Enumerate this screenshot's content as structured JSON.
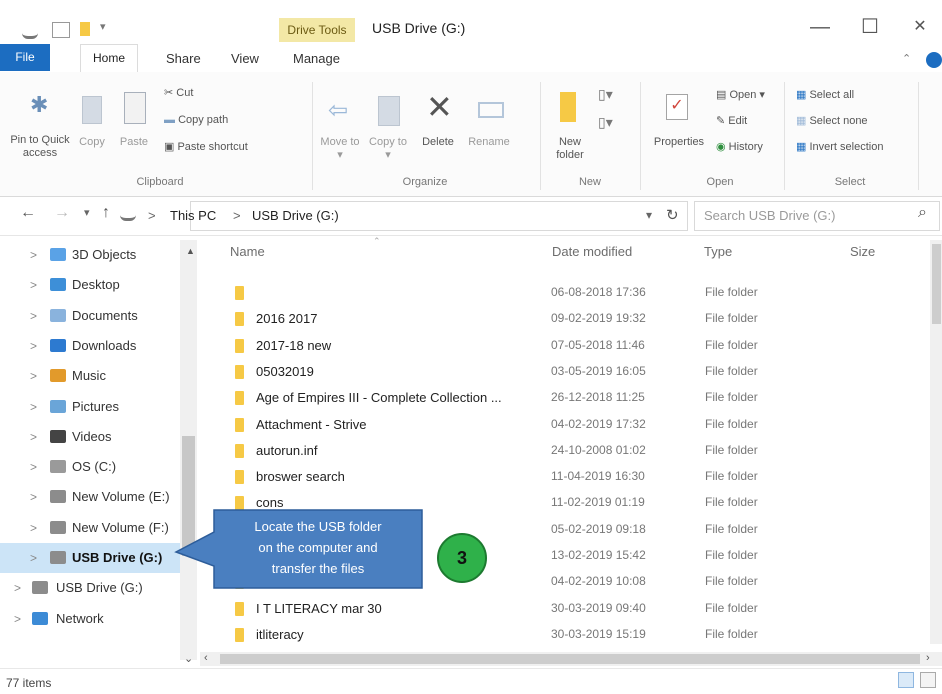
{
  "window": {
    "title": "USB Drive (G:)",
    "contextual_tab": "Drive Tools",
    "minimize": "—",
    "maximize": "☐",
    "close": "✕"
  },
  "ribbon_tabs": [
    "File",
    "Home",
    "Share",
    "View",
    "Manage"
  ],
  "ribbon": {
    "clipboard": {
      "pin_label": "Pin to Quick access",
      "copy_label": "Copy",
      "paste_label": "Paste",
      "cut_label": "Cut",
      "copy_path_label": "Copy path",
      "paste_shortcut_label": "Paste shortcut",
      "group_label": "Clipboard"
    },
    "organize": {
      "move_to_label": "Move to ▾",
      "copy_to_label": "Copy to ▾",
      "delete_label": "Delete",
      "rename_label": "Rename",
      "group_label": "Organize"
    },
    "new": {
      "new_folder_label": "New folder",
      "group_label": "New"
    },
    "open": {
      "properties_label": "Properties",
      "open_label": "Open ▾",
      "edit_label": "Edit",
      "history_label": "History",
      "group_label": "Open"
    },
    "select": {
      "select_all_label": "Select all",
      "select_none_label": "Select none",
      "invert_label": "Invert selection",
      "group_label": "Select"
    }
  },
  "address": {
    "back": "←",
    "forward": "→",
    "recent": "▾",
    "up": "↑",
    "breadcrumb_root": "This PC",
    "breadcrumb_sep": ">",
    "breadcrumb_current": "USB Drive (G:)",
    "dropdown": "▾",
    "refresh": "↻",
    "search_placeholder": "Search USB Drive (G:)",
    "search_icon": "⌕"
  },
  "nav": [
    {
      "label": "3D Objects",
      "icon_color": "#5aa2e6",
      "selected": false
    },
    {
      "label": "Desktop",
      "icon_color": "#3d8fd8",
      "selected": false
    },
    {
      "label": "Documents",
      "icon_color": "#8ab3dd",
      "selected": false
    },
    {
      "label": "Downloads",
      "icon_color": "#2d7ad0",
      "selected": false
    },
    {
      "label": "Music",
      "icon_color": "#e29a2b",
      "selected": false
    },
    {
      "label": "Pictures",
      "icon_color": "#6aa5d8",
      "selected": false
    },
    {
      "label": "Videos",
      "icon_color": "#444444",
      "selected": false
    },
    {
      "label": "OS (C:)",
      "icon_color": "#9a9a9a",
      "selected": false
    },
    {
      "label": "New Volume (E:)",
      "icon_color": "#8c8c8c",
      "selected": false
    },
    {
      "label": "New Volume (F:)",
      "icon_color": "#8c8c8c",
      "selected": false
    },
    {
      "label": "USB Drive (G:)",
      "icon_color": "#8c8c8c",
      "selected": true
    },
    {
      "label": "USB Drive (G:)",
      "icon_color": "#8c8c8c",
      "selected": false
    },
    {
      "label": "Network",
      "icon_color": "#3c8bd6",
      "selected": false
    }
  ],
  "columns": {
    "name": "Name",
    "date": "Date modified",
    "type": "Type",
    "size": "Size"
  },
  "files": [
    {
      "name": "",
      "date": "06-08-2018 17:36",
      "type": "File folder"
    },
    {
      "name": "2016 2017",
      "date": "09-02-2019 19:32",
      "type": "File folder"
    },
    {
      "name": "2017-18 new",
      "date": "07-05-2018 11:46",
      "type": "File folder"
    },
    {
      "name": "05032019",
      "date": "03-05-2019 16:05",
      "type": "File folder"
    },
    {
      "name": "Age of Empires III - Complete Collection ...",
      "date": "26-12-2018 11:25",
      "type": "File folder"
    },
    {
      "name": "Attachment - Strive",
      "date": "04-02-2019 17:32",
      "type": "File folder"
    },
    {
      "name": "autorun.inf",
      "date": "24-10-2008 01:02",
      "type": "File folder"
    },
    {
      "name": "broswer search",
      "date": "11-04-2019 16:30",
      "type": "File folder"
    },
    {
      "name": "cons",
      "date": "11-02-2019 01:19",
      "type": "File folder"
    },
    {
      "name": "",
      "date": "05-02-2019 09:18",
      "type": "File folder"
    },
    {
      "name": "",
      "date": "13-02-2019 15:42",
      "type": "File folder"
    },
    {
      "name": "",
      "date": "04-02-2019 10:08",
      "type": "File folder"
    },
    {
      "name": "I T LITERACY mar 30",
      "date": "30-03-2019 09:40",
      "type": "File folder"
    },
    {
      "name": "itliteracy",
      "date": "30-03-2019 15:19",
      "type": "File folder"
    }
  ],
  "status": {
    "items": "77 items"
  },
  "callout": {
    "text_line1": "Locate the USB folder",
    "text_line2": "on the computer and",
    "text_line3": "transfer the files",
    "step": "3",
    "box_color": "#4a7fc0",
    "badge_color": "#2fb14a"
  },
  "colors": {
    "accent": "#1c6dc1",
    "selected": "#cce4f7",
    "folder": "#f6c945"
  }
}
